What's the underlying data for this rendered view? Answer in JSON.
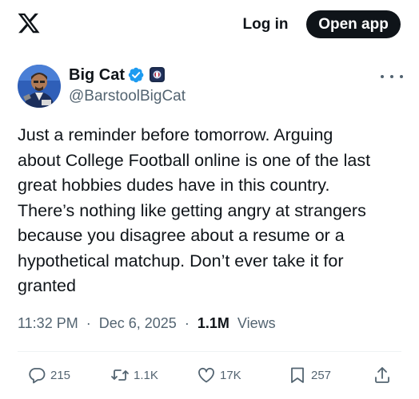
{
  "header": {
    "logo_icon": "x-logo-icon",
    "login_label": "Log in",
    "open_app_label": "Open app"
  },
  "tweet": {
    "author": {
      "display_name": "Big Cat",
      "handle": "@BarstoolBigCat",
      "verified_icon": "verified-badge-icon",
      "affiliation_icon": "affiliation-badge-icon",
      "avatar_icon": "avatar-photo"
    },
    "more_icon": "more-options-icon",
    "text_lines": [
      "Just a reminder before tomorrow. Arguing",
      "about College Football online is one of the last",
      "great hobbies dudes have in this country.",
      "There’s nothing like getting angry at strangers",
      "because you disagree about a resume or a",
      "hypothetical matchup. Don’t ever take it for",
      "granted"
    ],
    "time": "11:32 PM",
    "separator": "·",
    "date": "Dec 6, 2025",
    "views_count": "1.1M",
    "views_label": "Views"
  },
  "actions": {
    "reply": {
      "icon": "reply-icon",
      "count": "215"
    },
    "repost": {
      "icon": "repost-icon",
      "count": "1.1K"
    },
    "like": {
      "icon": "heart-icon",
      "count": "17K"
    },
    "bookmark": {
      "icon": "bookmark-icon",
      "count": "257"
    },
    "share": {
      "icon": "share-icon"
    }
  },
  "colors": {
    "text_primary": "#0f1419",
    "text_secondary": "#536471",
    "verified_blue": "#1d9bf0",
    "button_dark": "#0f1419",
    "divider": "#eff3f4"
  }
}
